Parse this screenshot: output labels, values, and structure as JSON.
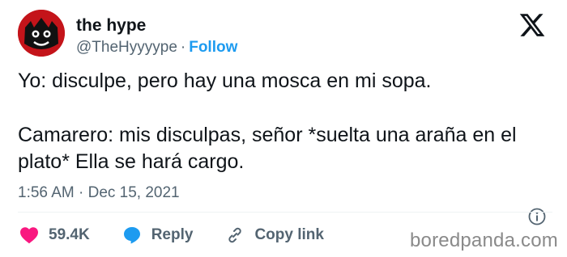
{
  "user": {
    "name": "the hype",
    "handle": "@TheHyyyype",
    "separator": "·",
    "follow_label": "Follow"
  },
  "tweet": {
    "line1": "Yo: disculpe, pero hay una mosca en mi sopa.",
    "line2": "Camarero: mis disculpas, señor *suelta una araña en el plato* Ella se hará cargo.",
    "timestamp": "1:56 AM · Dec 15, 2021"
  },
  "actions": {
    "likes": "59.4K",
    "reply_label": "Reply",
    "copy_label": "Copy link"
  },
  "icons": {
    "platform": "x-logo-icon",
    "info": "info-icon",
    "like": "heart-icon",
    "reply": "reply-bubble-icon",
    "copy": "link-icon"
  },
  "watermark": "boredpanda.com",
  "colors": {
    "follow": "#1d9bf0",
    "heart": "#f91880",
    "reply": "#1d9bf0",
    "avatar_bg": "#c4141a"
  }
}
